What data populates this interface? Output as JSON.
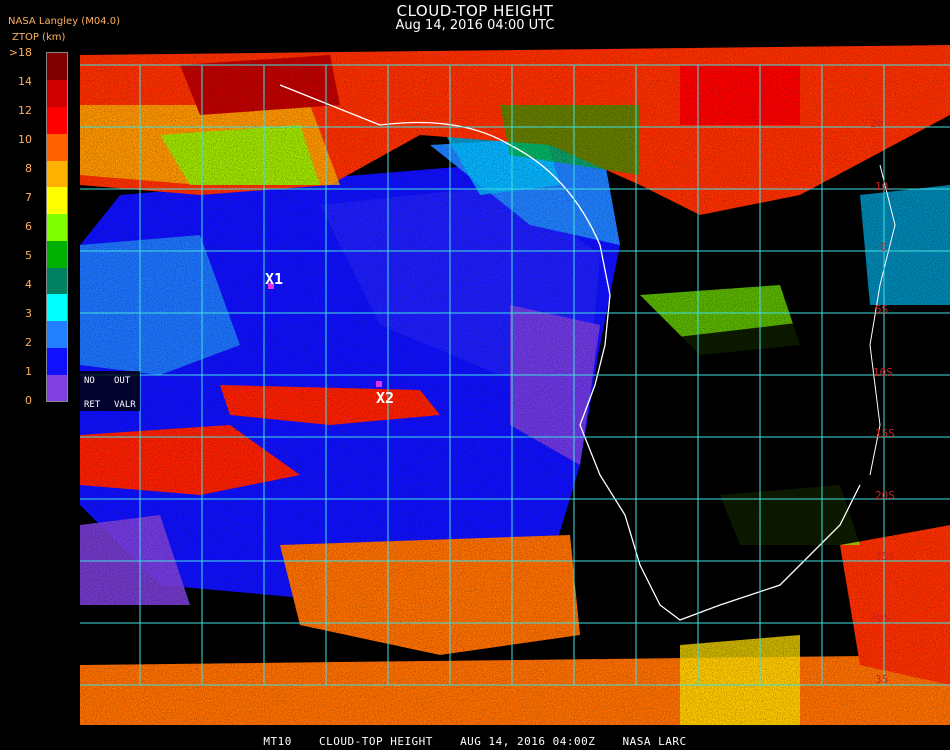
{
  "header": {
    "title": "CLOUD-TOP HEIGHT",
    "time": "Aug 14, 2016 04:00 UTC",
    "source": "NASA Langley (M04.0)",
    "unit": "ZTOP (km)"
  },
  "legend": {
    "colors": [
      "#8040e0",
      "#1010ff",
      "#2080ff",
      "#00ffff",
      "#008060",
      "#00b000",
      "#80ff00",
      "#ffff00",
      "#ffb000",
      "#ff6000",
      "#ff0000",
      "#d00000",
      "#800000"
    ],
    "ticks": [
      ">18",
      "14",
      "12",
      "10",
      "8",
      "7",
      "6",
      "5",
      "4",
      "3",
      "2",
      "1",
      "0"
    ]
  },
  "flags": {
    "no": "NO",
    "out": "OUT",
    "ret": "RET",
    "valr": "VALR"
  },
  "points": [
    {
      "label": "X1",
      "color": "#e030e0"
    },
    {
      "label": "X2",
      "color": "#e030e0"
    }
  ],
  "lat_labels": [
    "20",
    "10",
    "0",
    "5S",
    "10S",
    "15S",
    "20S",
    "25S",
    "30S",
    "35"
  ],
  "footer": {
    "sat": "MT10",
    "product": "CLOUD-TOP HEIGHT",
    "datetime": "AUG 14, 2016 04:00Z",
    "org": "NASA LARC"
  },
  "colors": {
    "grid": "#40e0e0",
    "coast": "#ffffff",
    "ocean_clear": "#000000"
  }
}
